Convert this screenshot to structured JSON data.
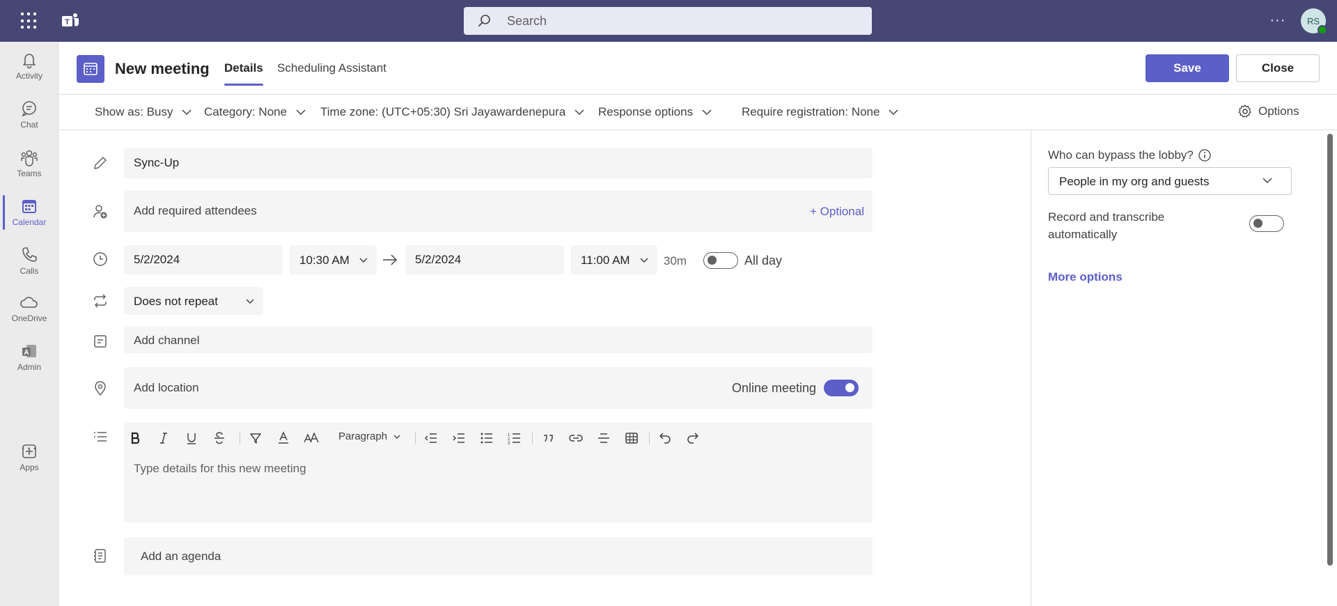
{
  "topbar": {
    "search_placeholder": "Search",
    "avatar_initials": "RS",
    "more_label": "···"
  },
  "rail": {
    "items": [
      {
        "label": "Activity",
        "icon": "bell-icon"
      },
      {
        "label": "Chat",
        "icon": "chat-icon"
      },
      {
        "label": "Teams",
        "icon": "teams-icon"
      },
      {
        "label": "Calendar",
        "icon": "calendar-icon",
        "active": true
      },
      {
        "label": "Calls",
        "icon": "phone-icon"
      },
      {
        "label": "OneDrive",
        "icon": "cloud-icon"
      },
      {
        "label": "Admin",
        "icon": "admin-icon"
      },
      {
        "label": "Apps",
        "icon": "apps-add-icon"
      }
    ],
    "more_label": "···"
  },
  "header": {
    "title": "New meeting",
    "tabs": [
      {
        "label": "Details",
        "active": true
      },
      {
        "label": "Scheduling Assistant",
        "active": false
      }
    ],
    "save_label": "Save",
    "close_label": "Close"
  },
  "options_bar": {
    "show_as": "Show as: Busy",
    "category": "Category: None",
    "time_zone": "Time zone: (UTC+05:30) Sri Jayawardenepura",
    "response": "Response options",
    "registration": "Require registration: None",
    "options": "Options"
  },
  "form": {
    "title_value": "Sync-Up",
    "attendees_placeholder": "Add required attendees",
    "optional_link": "+ Optional",
    "start_date": "5/2/2024",
    "start_time": "10:30 AM",
    "end_date": "5/2/2024",
    "end_time": "11:00 AM",
    "duration": "30m",
    "all_day_label": "All day",
    "all_day_on": false,
    "repeat": "Does not repeat",
    "channel_placeholder": "Add channel",
    "location_placeholder": "Add location",
    "online_meeting_label": "Online meeting",
    "online_meeting_on": true,
    "editor": {
      "paragraph_label": "Paragraph",
      "placeholder": "Type details for this new meeting"
    },
    "agenda_placeholder": "Add an agenda"
  },
  "right_panel": {
    "lobby_label": "Who can bypass the lobby?",
    "lobby_value": "People in my org and guests",
    "record_label": "Record and transcribe automatically",
    "record_on": false,
    "more_options": "More options"
  },
  "colors": {
    "topbar": "#464775",
    "accent": "#5b5fc7",
    "field_bg": "#f5f5f5"
  }
}
